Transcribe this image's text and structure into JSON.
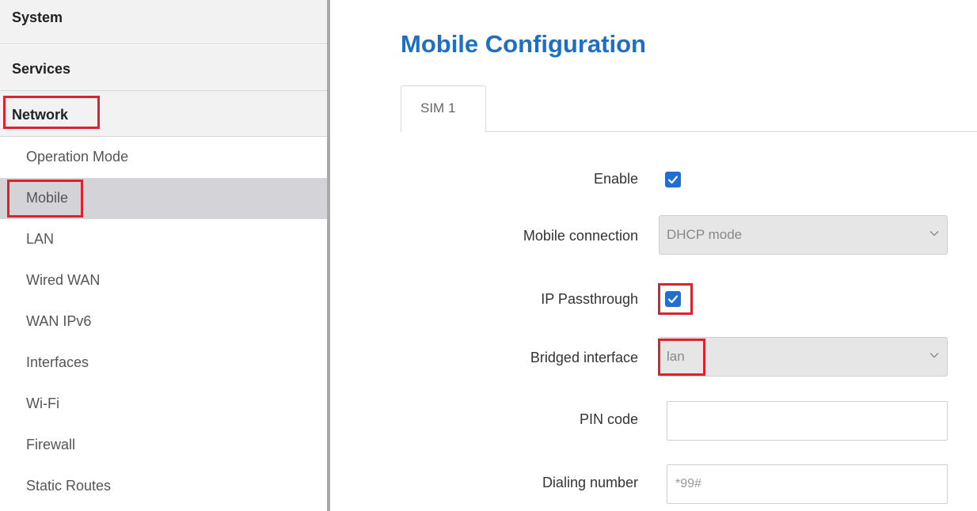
{
  "sidebar": {
    "categories": [
      "System",
      "Services",
      "Network"
    ],
    "items": [
      "Operation Mode",
      "Mobile",
      "LAN",
      "Wired WAN",
      "WAN IPv6",
      "Interfaces",
      "Wi-Fi",
      "Firewall",
      "Static Routes"
    ],
    "active_item": "Mobile"
  },
  "main": {
    "title": "Mobile Configuration",
    "tabs": [
      "SIM 1"
    ],
    "fields": {
      "enable": {
        "label": "Enable",
        "checked": true
      },
      "mobile_connection": {
        "label": "Mobile connection",
        "value": "DHCP mode"
      },
      "ip_passthrough": {
        "label": "IP Passthrough",
        "checked": true
      },
      "bridged_interface": {
        "label": "Bridged interface",
        "value": "lan"
      },
      "pin_code": {
        "label": "PIN code",
        "value": ""
      },
      "dialing_number": {
        "label": "Dialing number",
        "placeholder": "*99#"
      }
    }
  },
  "colors": {
    "accent": "#1d6fc4",
    "checkbox": "#1f6fd0",
    "highlight": "#d9232e",
    "active_item_bg": "#d4d4d8"
  }
}
